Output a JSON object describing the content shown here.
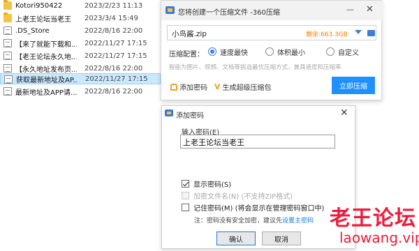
{
  "files": [
    {
      "name": "Kotori950422",
      "date": "2023/2/23 11:13",
      "type": "folder"
    },
    {
      "name": "上老王论坛当老王",
      "date": "2023/3/4 15:49",
      "type": "folder"
    },
    {
      "name": ".DS_Store",
      "date": "2022/8/16 22:00",
      "type": "file"
    },
    {
      "name": "【来了就能下载和...",
      "date": "2022/11/27 17:15",
      "type": "file"
    },
    {
      "name": "【老王论坛永久地...",
      "date": "2022/11/27 17:15",
      "type": "file"
    },
    {
      "name": "【永久地址发布页...",
      "date": "2022/8/16 22:00",
      "type": "file"
    },
    {
      "name": "获取最新地址及AP...",
      "date": "2022/11/27 17:15",
      "type": "file"
    },
    {
      "name": "最新地址及APP请...",
      "date": "2022/8/16 22:00",
      "type": "file"
    }
  ],
  "compress": {
    "title": "您将创建一个压缩文件 -360压缩",
    "minimize": "—",
    "close": "✕",
    "filename": "小鸟酱.zip",
    "space": "剩余:663.3GB",
    "config_label": "压缩配置：",
    "options": [
      "速度最快",
      "体积最小",
      "自定义"
    ],
    "selected": "速度最快",
    "hint": "智能为图片、视频、文档等挑选最优压缩方式，兼具速度和压缩率",
    "add_password": "添加密码",
    "vip_mark": "V",
    "gen_package": "生成超级压缩包",
    "compress_btn": "立即压缩"
  },
  "password": {
    "title": "添加密码",
    "close": "✕",
    "input_label": "输入密码(E)",
    "input_value": "上老王论坛当老王",
    "show_password": "显示密码(S)",
    "encrypt_names": "加密文件名(N) (不支持ZIP格式)",
    "remember": "记住密码(M) (将会显示在管理密码窗口中)",
    "note_prefix": "注：密码没有安全加密，建议先",
    "note_link": "设置主密码",
    "ok": "确认",
    "cancel": "取消"
  },
  "watermark": {
    "cn": "老王论坛",
    "en": "laowang.vip"
  },
  "colors": {
    "accent": "#1e90ff",
    "space": "#ff7d00",
    "watermark": "#ee1b3a"
  }
}
